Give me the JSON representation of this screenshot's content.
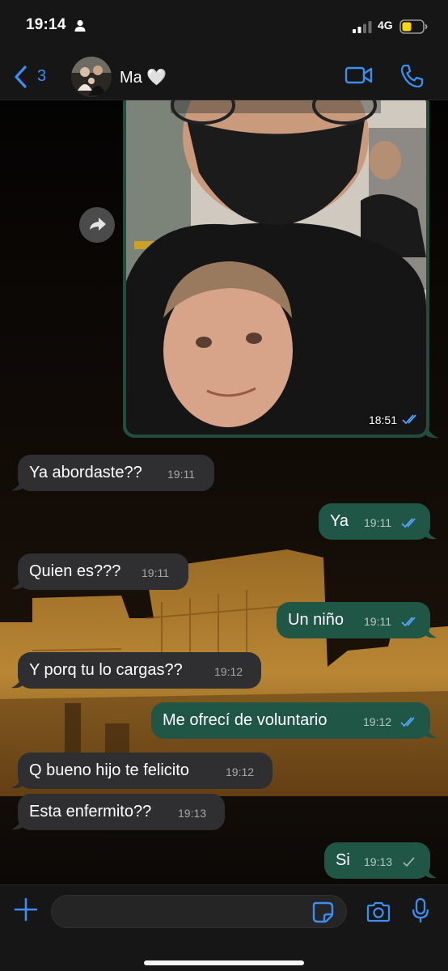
{
  "status_bar": {
    "time": "19:14",
    "network": "4G"
  },
  "header": {
    "back_count": "3",
    "contact_name": "Ma 🤍"
  },
  "photo_message": {
    "time": "18:51"
  },
  "messages": [
    {
      "dir": "in",
      "text": "Ya abordaste??",
      "time": "19:11"
    },
    {
      "dir": "out",
      "text": "Ya",
      "time": "19:11"
    },
    {
      "dir": "in",
      "text": "Quien es???",
      "time": "19:11"
    },
    {
      "dir": "out",
      "text": "Un niño",
      "time": "19:11"
    },
    {
      "dir": "in",
      "text": "Y porq tu lo cargas??",
      "time": "19:12"
    },
    {
      "dir": "out",
      "text": "Me ofrecí de voluntario",
      "time": "19:12"
    },
    {
      "dir": "in",
      "text": "Q bueno hijo te felicito",
      "time": "19:12"
    },
    {
      "dir": "in",
      "text": "Esta enfermito??",
      "time": "19:13"
    },
    {
      "dir": "out",
      "text": "Si",
      "time": "19:13"
    }
  ],
  "input": {
    "value": "",
    "placeholder": ""
  },
  "colors": {
    "accent": "#3b8ff0",
    "outgoing": "#1f5646",
    "incoming": "#2f2f31",
    "read_ticks": "#53a6ff"
  }
}
